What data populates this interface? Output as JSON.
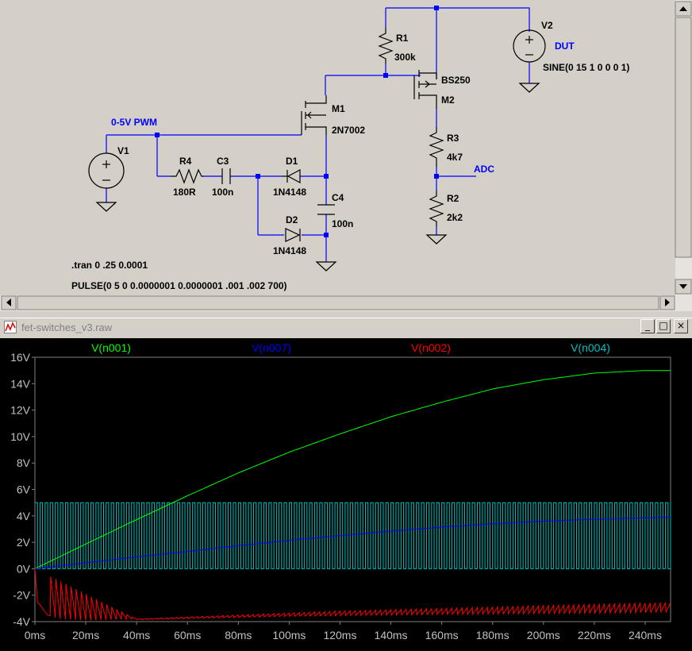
{
  "schematic": {
    "net_labels": [
      "0-5V PWM",
      "DUT",
      "ADC"
    ],
    "components": [
      {
        "ref": "V1",
        "value": ""
      },
      {
        "ref": "V2",
        "value": "SINE(0 15 1 0 0 0 1)"
      },
      {
        "ref": "R1",
        "value": "300k"
      },
      {
        "ref": "R2",
        "value": "2k2"
      },
      {
        "ref": "R3",
        "value": "4k7"
      },
      {
        "ref": "R4",
        "value": "180R"
      },
      {
        "ref": "C3",
        "value": "100n"
      },
      {
        "ref": "C4",
        "value": "100n"
      },
      {
        "ref": "D1",
        "value": "1N4148"
      },
      {
        "ref": "D2",
        "value": "1N4148"
      },
      {
        "ref": "M1",
        "value": "2N7002"
      },
      {
        "ref": "M2",
        "value": "BS250"
      }
    ],
    "directives": [
      ".tran 0 .25 0.0001",
      "PULSE(0 5 0 0.0000001 0.0000001 .001 .002 700)"
    ]
  },
  "waveform_window": {
    "title": "fet-switches_v3.raw",
    "buttons": [
      "minimize",
      "maximize",
      "close"
    ]
  },
  "colors": {
    "background": "#000000",
    "v_n001": "#00ff00",
    "v_n007": "#0000ff",
    "v_n002": "#ff0000",
    "v_n004": "#00c0c0",
    "wire": "#0000ff",
    "component": "#000000"
  },
  "chart_data": {
    "type": "line",
    "xlabel": "",
    "ylabel": "",
    "xlim": [
      0,
      250
    ],
    "ylim": [
      -4,
      16
    ],
    "x_ticks": [
      "0ms",
      "20ms",
      "40ms",
      "60ms",
      "80ms",
      "100ms",
      "120ms",
      "140ms",
      "160ms",
      "180ms",
      "200ms",
      "220ms",
      "240ms"
    ],
    "y_ticks": [
      "16V",
      "14V",
      "12V",
      "10V",
      "8V",
      "6V",
      "4V",
      "2V",
      "0V",
      "-2V",
      "-4V"
    ],
    "grid": false,
    "series": [
      {
        "name": "V(n001)",
        "description_kind": "sine_quarter",
        "amplitude": 15,
        "period_ms": 1000,
        "x": [
          0,
          20,
          40,
          60,
          80,
          100,
          120,
          140,
          160,
          180,
          200,
          220,
          240,
          250
        ],
        "values": [
          0,
          1.87,
          3.72,
          5.52,
          7.25,
          8.82,
          10.2,
          11.5,
          12.6,
          13.6,
          14.3,
          14.8,
          15.0,
          15.0
        ]
      },
      {
        "name": "V(n007)",
        "x": [
          0,
          20,
          40,
          60,
          80,
          100,
          120,
          140,
          160,
          180,
          200,
          220,
          240,
          250
        ],
        "values": [
          0,
          0.45,
          0.9,
          1.3,
          1.75,
          2.15,
          2.5,
          2.85,
          3.15,
          3.4,
          3.6,
          3.75,
          3.85,
          3.9
        ]
      },
      {
        "name": "V(n002)",
        "x": [
          0,
          1,
          5,
          10,
          20,
          40,
          80,
          120,
          160,
          200,
          240,
          250
        ],
        "values": [
          0,
          -2.5,
          -3.5,
          -3.8,
          -3.9,
          -3.8,
          -3.5,
          -3.2,
          -3.0,
          -2.8,
          -2.6,
          -2.55
        ],
        "ripple_min_x": [
          0,
          40,
          100,
          160,
          250
        ],
        "ripple_min": [
          0,
          -3.85,
          -3.6,
          -3.45,
          -3.3
        ]
      },
      {
        "name": "V(n004)",
        "kind": "square",
        "low": 0,
        "high": 5,
        "period_ms": 2,
        "duty": 0.5,
        "x_start": 0,
        "x_end": 250
      }
    ]
  }
}
